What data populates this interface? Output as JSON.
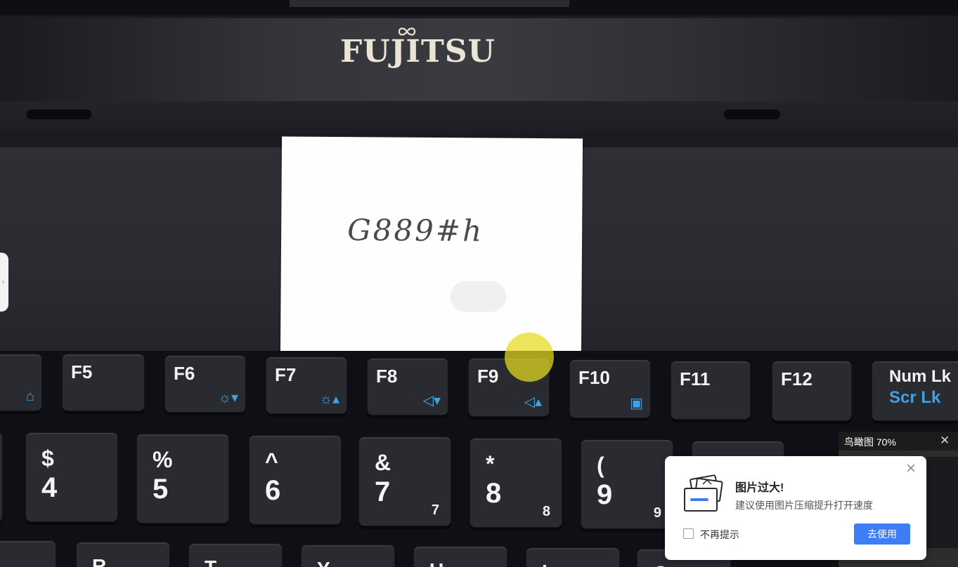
{
  "photo": {
    "brand_logo": "FUJITSU",
    "note_text": "G889#h",
    "function_keys": [
      {
        "label": "",
        "icon": "mouse-icon"
      },
      {
        "label": "F5",
        "icon": ""
      },
      {
        "label": "F6",
        "icon": "brightness-down-icon",
        "glyph": "☼▾"
      },
      {
        "label": "F7",
        "icon": "brightness-up-icon",
        "glyph": "☼▴"
      },
      {
        "label": "F8",
        "icon": "volume-down-icon",
        "glyph": "◁▾"
      },
      {
        "label": "F9",
        "icon": "volume-up-icon",
        "glyph": "◁▴"
      },
      {
        "label": "F10",
        "icon": "display-switch-icon",
        "glyph": "▣"
      },
      {
        "label": "F11",
        "icon": ""
      },
      {
        "label": "F12",
        "icon": ""
      },
      {
        "label": "Num Lk",
        "secondary": "Scr Lk"
      }
    ],
    "number_keys": [
      {
        "top": "$",
        "bottom": "4",
        "sub": ""
      },
      {
        "top": "%",
        "bottom": "5",
        "sub": ""
      },
      {
        "top": "^",
        "bottom": "6",
        "sub": ""
      },
      {
        "top": "&",
        "bottom": "7",
        "sub": "7"
      },
      {
        "top": "*",
        "bottom": "8",
        "sub": "8"
      },
      {
        "top": "(",
        "bottom": "9",
        "sub": "9"
      },
      {
        "top": ")",
        "bottom": "",
        "sub": ""
      }
    ],
    "bottom_keys": [
      "R",
      "T",
      "Y",
      "U",
      "I",
      "O"
    ]
  },
  "minimap": {
    "title": "鸟瞰图 70%",
    "close_icon": "close-icon"
  },
  "toast": {
    "title": "图片过大!",
    "description": "建议使用图片压缩提升打开速度",
    "checkbox_label": "不再提示",
    "action_label": "去使用",
    "close_icon": "close-icon",
    "illustration_icon": "images-icon",
    "accent_color": "#3d7df5"
  }
}
